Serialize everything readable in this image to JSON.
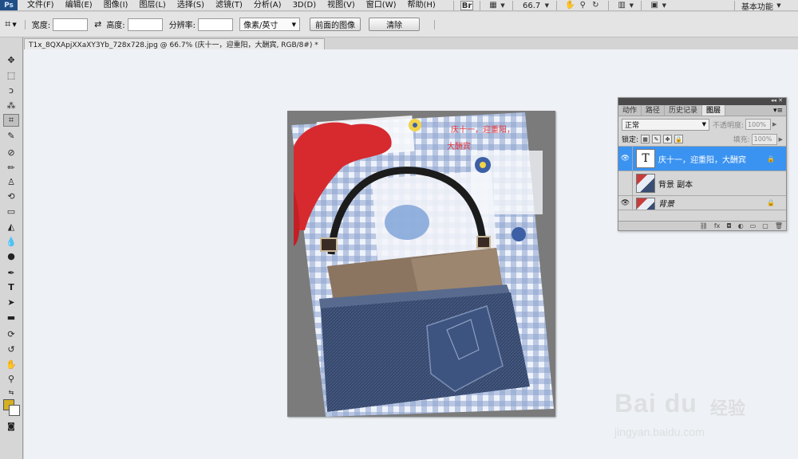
{
  "app": {
    "logo": "Ps"
  },
  "menu": [
    "文件(F)",
    "编辑(E)",
    "图像(I)",
    "图层(L)",
    "选择(S)",
    "滤镜(T)",
    "分析(A)",
    "3D(D)",
    "视图(V)",
    "窗口(W)",
    "帮助(H)"
  ],
  "menubar_right": {
    "bridge": "Br",
    "zoom": "66.7",
    "workspace": "基本功能"
  },
  "options": {
    "width_label": "宽度:",
    "height_label": "高度:",
    "resolution_label": "分辨率:",
    "unit": "像素/英寸",
    "front_image_button": "前面的图像",
    "clear_button": "清除",
    "width_value": "",
    "height_value": "",
    "resolution_value": ""
  },
  "document_tab": {
    "title": "T1x_8QXApjXXaXY3Yb_728x728.jpg @ 66.7% (庆十一，迎重阳，大酬宾, RGB/8#) *",
    "close": "×"
  },
  "canvas_text": [
    "庆十一，迎重阳，",
    "大酬宾"
  ],
  "layers_panel": {
    "collapse": "◂◂ ✕",
    "tabs": [
      "动作",
      "路径",
      "历史记录",
      "图层"
    ],
    "active_tab": "图层",
    "blend_mode": "正常",
    "opacity_label": "不透明度:",
    "opacity_value": "100%",
    "lock_label": "锁定:",
    "fill_label": "填充:",
    "fill_value": "100%",
    "layers": [
      {
        "name": "庆十一，迎重阳，大酬宾",
        "thumb": "T",
        "visible": true,
        "selected": true,
        "locked": true
      },
      {
        "name": "背景 副本",
        "visible": false,
        "selected": false,
        "locked": false
      },
      {
        "name": "背景",
        "visible": true,
        "selected": false,
        "locked": true
      }
    ]
  },
  "colors": {
    "foreground": "#d4b021",
    "background": "#ffffff",
    "selected_layer": "#3b93f1",
    "menubar": "#e2e2e2"
  },
  "watermark": {
    "brand": "Bai du",
    "cn": "经验",
    "url": "jingyan.baidu.com"
  }
}
